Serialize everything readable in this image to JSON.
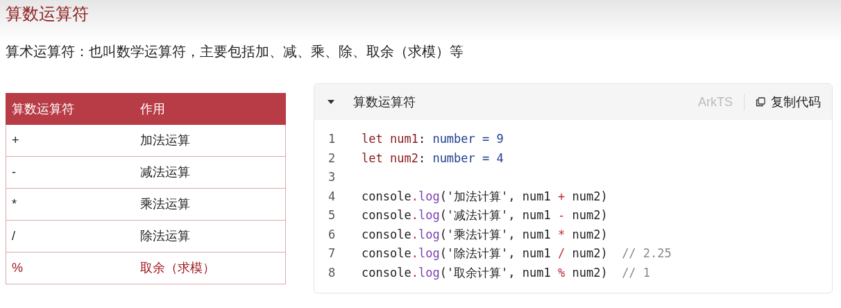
{
  "page_title": "算数运算符",
  "description": "算术运算符：也叫数学运算符，主要包括加、减、乘、除、取余（求模）等",
  "table": {
    "columns": [
      "算数运算符",
      "作用"
    ],
    "rows": [
      {
        "cells": [
          "+",
          "加法运算"
        ],
        "highlighted": false
      },
      {
        "cells": [
          "-",
          "减法运算"
        ],
        "highlighted": false
      },
      {
        "cells": [
          "*",
          "乘法运算"
        ],
        "highlighted": false
      },
      {
        "cells": [
          "/",
          "除法运算"
        ],
        "highlighted": false
      },
      {
        "cells": [
          "%",
          "取余（求模）"
        ],
        "highlighted": true
      }
    ]
  },
  "code_block": {
    "title": "算数运算符",
    "expanded": true,
    "language": "ArkTS",
    "copy_label": "复制代码",
    "lines": [
      {
        "number": "1",
        "tokens": [
          {
            "text": "let ",
            "kind": "keyword"
          },
          {
            "text": "num1",
            "kind": "keyword"
          },
          {
            "text": ": ",
            "kind": "plain"
          },
          {
            "text": "number",
            "kind": "type"
          },
          {
            "text": " = 9",
            "kind": "type"
          }
        ]
      },
      {
        "number": "2",
        "tokens": [
          {
            "text": "let ",
            "kind": "keyword"
          },
          {
            "text": "num2",
            "kind": "keyword"
          },
          {
            "text": ": ",
            "kind": "plain"
          },
          {
            "text": "number",
            "kind": "type"
          },
          {
            "text": " = 4",
            "kind": "type"
          }
        ]
      },
      {
        "number": "3"
      },
      {
        "number": "4",
        "tokens": [
          {
            "text": "console",
            "kind": "plain"
          },
          {
            "text": ".",
            "kind": "operator"
          },
          {
            "text": "log",
            "kind": "function"
          },
          {
            "text": "('加法计算', num1 ",
            "kind": "plain"
          },
          {
            "text": "+",
            "kind": "operator"
          },
          {
            "text": " num2)",
            "kind": "plain"
          }
        ]
      },
      {
        "number": "5",
        "tokens": [
          {
            "text": "console",
            "kind": "plain"
          },
          {
            "text": ".",
            "kind": "operator"
          },
          {
            "text": "log",
            "kind": "function"
          },
          {
            "text": "('减法计算', num1 ",
            "kind": "plain"
          },
          {
            "text": "-",
            "kind": "operator"
          },
          {
            "text": " num2)",
            "kind": "plain"
          }
        ]
      },
      {
        "number": "6",
        "tokens": [
          {
            "text": "console",
            "kind": "plain"
          },
          {
            "text": ".",
            "kind": "operator"
          },
          {
            "text": "log",
            "kind": "function"
          },
          {
            "text": "('乘法计算', num1 ",
            "kind": "plain"
          },
          {
            "text": "*",
            "kind": "operator"
          },
          {
            "text": " num2)",
            "kind": "plain"
          }
        ]
      },
      {
        "number": "7",
        "tokens": [
          {
            "text": "console",
            "kind": "plain"
          },
          {
            "text": ".",
            "kind": "operator"
          },
          {
            "text": "log",
            "kind": "function"
          },
          {
            "text": "('除法计算', num1 ",
            "kind": "plain"
          },
          {
            "text": "/",
            "kind": "operator"
          },
          {
            "text": " num2)  ",
            "kind": "plain"
          },
          {
            "text": "// 2.25",
            "kind": "comment"
          }
        ]
      },
      {
        "number": "8",
        "tokens": [
          {
            "text": "console",
            "kind": "plain"
          },
          {
            "text": ".",
            "kind": "operator"
          },
          {
            "text": "log",
            "kind": "function"
          },
          {
            "text": "('取余计算', num1 ",
            "kind": "plain"
          },
          {
            "text": "%",
            "kind": "operator"
          },
          {
            "text": " num2)  ",
            "kind": "plain"
          },
          {
            "text": "// 1",
            "kind": "comment"
          }
        ]
      }
    ]
  }
}
